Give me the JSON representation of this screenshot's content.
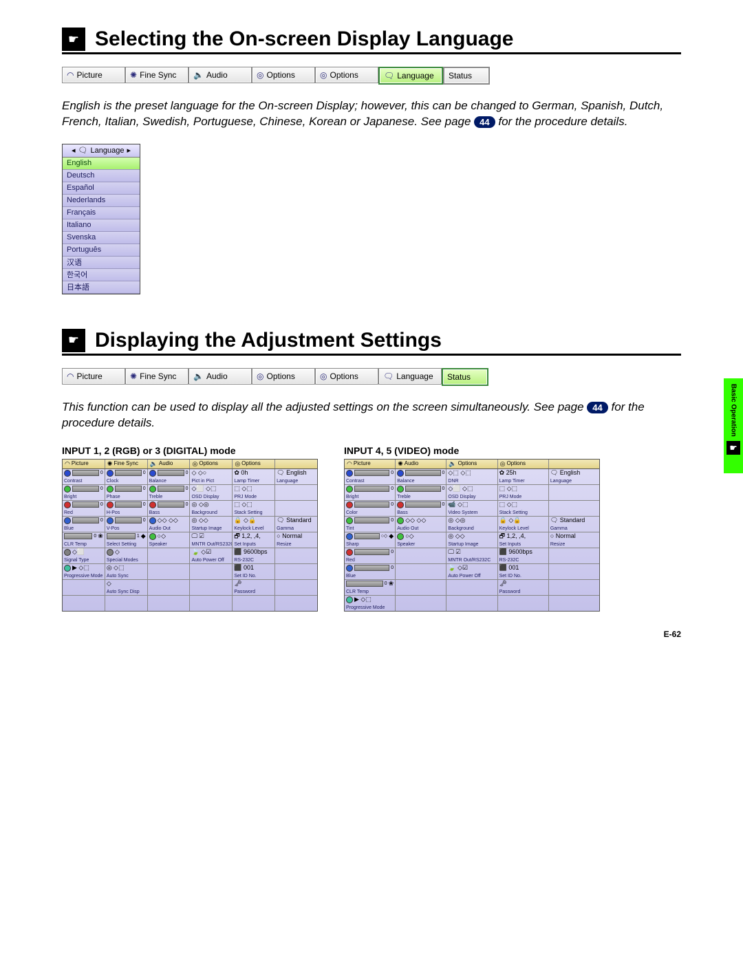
{
  "section1": {
    "title": "Selecting the On-screen Display Language",
    "tabs": [
      "Picture",
      "Fine Sync",
      "Audio",
      "Options",
      "Options",
      "Language",
      "Status"
    ],
    "selected_tab": 5,
    "body_pre": "English is the preset language for the On-screen Display; however, this can be changed to German, Spanish, Dutch, French, Italian, Swedish, Portuguese, Chinese, Korean or Japanese. See page ",
    "page_ref": "44",
    "body_post": " for the procedure details."
  },
  "lang_menu": {
    "header": "Language",
    "items": [
      "English",
      "Deutsch",
      "Español",
      "Nederlands",
      "Français",
      "Italiano",
      "Svenska",
      "Português",
      "汉语",
      "한국어",
      "日本語"
    ],
    "selected": 0
  },
  "section2": {
    "title": "Displaying the Adjustment Settings",
    "tabs": [
      "Picture",
      "Fine Sync",
      "Audio",
      "Options",
      "Options",
      "Language",
      "Status"
    ],
    "selected_tab": 6,
    "body_pre": "This function can be used to display all the adjusted settings on the screen simultaneously. See page ",
    "page_ref": "44",
    "body_post": " for the procedure details."
  },
  "status_left": {
    "title": "INPUT 1, 2 (RGB) or 3 (DIGITAL) mode",
    "headers": [
      "Picture",
      "Fine Sync",
      "Audio",
      "Options",
      "Options"
    ],
    "rows": [
      [
        {
          "icon_color": "#2a4ad0",
          "bar": true,
          "val": "0",
          "label": "Contrast"
        },
        {
          "icon_color": "#2a4ad0",
          "bar": true,
          "val": "0",
          "label": "Clock"
        },
        {
          "icon_color": "#2a4ad0",
          "bar": true,
          "val": "0",
          "label": "Balance"
        },
        {
          "glyph": "◇ ◇○",
          "label": "Pict in Pict"
        },
        {
          "glyph": "✿ 0h",
          "label": "Lamp Timer"
        },
        {
          "glyph": "🗨 English",
          "label": "Language"
        }
      ],
      [
        {
          "icon_color": "#40c040",
          "bar": true,
          "val": "0",
          "label": "Bright"
        },
        {
          "icon_color": "#40c040",
          "bar": true,
          "val": "0",
          "label": "Phase"
        },
        {
          "icon_color": "#40c040",
          "bar": true,
          "val": "0",
          "label": "Treble"
        },
        {
          "glyph": "◇⬜ ◇⬚",
          "label": "OSD Display"
        },
        {
          "glyph": "⬚ ◇⬚",
          "label": "PRJ Mode"
        },
        {
          "empty": true
        }
      ],
      [
        {
          "icon_color": "#d03030",
          "bar": true,
          "val": "0",
          "label": "Red"
        },
        {
          "icon_color": "#d03030",
          "bar": true,
          "val": "0",
          "label": "H-Pos"
        },
        {
          "icon_color": "#d03030",
          "bar": true,
          "val": "0",
          "label": "Bass"
        },
        {
          "glyph": "◎ ◇◎",
          "label": "Background"
        },
        {
          "glyph": "⬚ ◇⬚",
          "label": "Stack Setting"
        },
        {
          "empty": true
        }
      ],
      [
        {
          "icon_color": "#3060d0",
          "bar": true,
          "val": "0",
          "label": "Blue"
        },
        {
          "icon_color": "#3060d0",
          "bar": true,
          "val": "0",
          "label": "V-Pos"
        },
        {
          "glyph": "◇◇ ◇◇",
          "icon_color": "#3060d0",
          "label": "Audio Out"
        },
        {
          "glyph": "◎ ◇◇",
          "label": "Startup Image"
        },
        {
          "glyph": "🔒 ◇🔒",
          "label": "Keylock Level"
        },
        {
          "glyph": "🗨 Standard",
          "label": "Gamma"
        }
      ],
      [
        {
          "glyph": "❀",
          "bar": true,
          "val": "0",
          "label": "CLR Temp"
        },
        {
          "glyph": "◆",
          "bar": true,
          "val": "1",
          "label": "Select Setting"
        },
        {
          "glyph": "○◇",
          "icon_color": "#40c040",
          "label": "Speaker"
        },
        {
          "glyph": "🖵 ☑",
          "label": "MNTR Out/RS232C"
        },
        {
          "glyph": "🗗 1,2, ,4,",
          "label": "Set Inputs"
        },
        {
          "glyph": "○ Normal",
          "label": "Resize"
        }
      ],
      [
        {
          "glyph": "◇⬜",
          "icon_color": "#808080",
          "label": "Signal Type"
        },
        {
          "glyph": "◇",
          "icon_color": "#808080",
          "label": "Special Modes"
        },
        {
          "empty": true
        },
        {
          "glyph": "🍃 ◇☑",
          "label": "Auto Power Off"
        },
        {
          "glyph": "⬛ 9600bps",
          "label": "RS-232C"
        },
        {
          "empty": true
        }
      ],
      [
        {
          "glyph": "▶ ◇⬚",
          "icon_color": "#40c0a0",
          "label": "Progressive Mode"
        },
        {
          "glyph": "◎ ◇⬚",
          "label": "Auto Sync"
        },
        {
          "empty": true
        },
        {
          "empty": true
        },
        {
          "glyph": "⬛ 001",
          "label": "Set ID No."
        },
        {
          "empty": true
        }
      ],
      [
        {
          "empty": true
        },
        {
          "glyph": "◇",
          "label": "Auto Sync Disp"
        },
        {
          "empty": true
        },
        {
          "empty": true
        },
        {
          "glyph": "🗝",
          "label": "Password"
        },
        {
          "empty": true
        }
      ],
      [
        {
          "empty": true
        },
        {
          "empty": true
        },
        {
          "empty": true
        },
        {
          "empty": true
        },
        {
          "empty": true
        },
        {
          "empty": true
        }
      ]
    ]
  },
  "status_right": {
    "title": "INPUT 4, 5 (VIDEO) mode",
    "headers": [
      "Picture",
      "Audio",
      "Options",
      "Options"
    ],
    "rows": [
      [
        {
          "icon_color": "#2a4ad0",
          "bar": true,
          "val": "0",
          "label": "Contrast"
        },
        {
          "icon_color": "#2a4ad0",
          "bar": true,
          "val": "0",
          "label": "Balance"
        },
        {
          "glyph": "◇⬚ ◇⬚",
          "label": "DNR"
        },
        {
          "glyph": "✿ 25h",
          "label": "Lamp Timer"
        },
        {
          "glyph": "🗨 English",
          "label": "Language"
        }
      ],
      [
        {
          "icon_color": "#40c040",
          "bar": true,
          "val": "0",
          "label": "Bright"
        },
        {
          "icon_color": "#40c040",
          "bar": true,
          "val": "0",
          "label": "Treble"
        },
        {
          "glyph": "◇⬜ ◇⬚",
          "label": "OSD Display"
        },
        {
          "glyph": "⬚ ◇⬚",
          "label": "PRJ Mode"
        },
        {
          "empty": true
        }
      ],
      [
        {
          "icon_color": "#d03030",
          "bar": true,
          "val": "0",
          "label": "Color"
        },
        {
          "icon_color": "#d03030",
          "bar": true,
          "val": "0",
          "label": "Bass"
        },
        {
          "glyph": "📹 ◇⬚",
          "label": "Video System"
        },
        {
          "glyph": "⬚ ◇⬚",
          "label": "Stack Setting"
        },
        {
          "empty": true
        }
      ],
      [
        {
          "icon_color": "#40c040",
          "bar": true,
          "val": "0",
          "label": "Tint"
        },
        {
          "glyph": "◇◇ ◇◇",
          "icon_color": "#40c040",
          "label": "Audio Out"
        },
        {
          "glyph": "◎ ◇◎",
          "label": "Background"
        },
        {
          "glyph": "🔒 ◇🔒",
          "label": "Keylock Level"
        },
        {
          "glyph": "🗨 Standard",
          "label": "Gamma"
        }
      ],
      [
        {
          "icon_color": "#3060d0",
          "glyph": "◆",
          "bar": true,
          "val": "○◇",
          "label": "Sharp"
        },
        {
          "glyph": "○◇",
          "icon_color": "#40c040",
          "label": "Speaker"
        },
        {
          "glyph": "◎ ◇◇",
          "label": "Startup Image"
        },
        {
          "glyph": "🗗 1,2, ,4,",
          "label": "Set Inputs"
        },
        {
          "glyph": "○ Normal",
          "label": "Resize"
        }
      ],
      [
        {
          "icon_color": "#d03030",
          "bar": true,
          "val": "0",
          "label": "Red"
        },
        {
          "empty": true
        },
        {
          "glyph": "🖵 ☑",
          "label": "MNTR Out/RS232C"
        },
        {
          "glyph": "⬛ 9600bps",
          "label": "RS-232C"
        },
        {
          "empty": true
        }
      ],
      [
        {
          "icon_color": "#3060d0",
          "bar": true,
          "val": "0",
          "label": "Blue"
        },
        {
          "empty": true
        },
        {
          "glyph": "🍃 ◇☑",
          "label": "Auto Power Off"
        },
        {
          "glyph": "⬛ 001",
          "label": "Set ID No."
        },
        {
          "empty": true
        }
      ],
      [
        {
          "glyph": "❀",
          "bar": true,
          "val": "0",
          "label": "CLR Temp"
        },
        {
          "empty": true
        },
        {
          "empty": true
        },
        {
          "glyph": "🗝",
          "label": "Password"
        },
        {
          "empty": true
        }
      ],
      [
        {
          "glyph": "▶ ◇⬚",
          "icon_color": "#40c0a0",
          "label": "Progressive Mode"
        },
        {
          "empty": true
        },
        {
          "empty": true
        },
        {
          "empty": true
        },
        {
          "empty": true
        }
      ]
    ]
  },
  "side_tab": "Basic Operation",
  "page_num": "E-62"
}
